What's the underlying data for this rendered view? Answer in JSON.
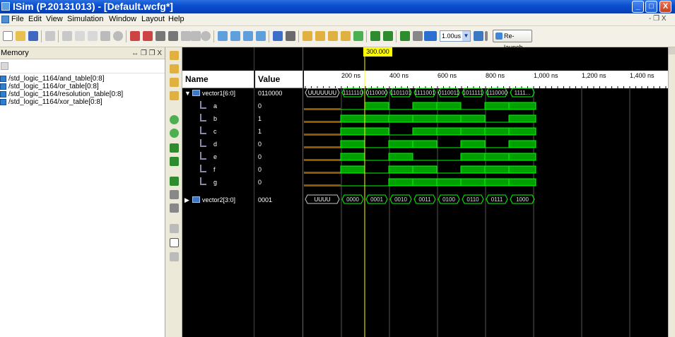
{
  "window": {
    "title": "ISim (P.20131013) - [Default.wcfg*]",
    "buttons": {
      "minimize": "_",
      "maximize": "□",
      "close": "X"
    }
  },
  "menu": {
    "items": [
      "File",
      "Edit",
      "View",
      "Simulation",
      "Window",
      "Layout",
      "Help"
    ],
    "window_controls": "- ❐ X"
  },
  "toolbar": {
    "run_time": "1.00us",
    "relaunch_label": "Re-launch"
  },
  "memory_panel": {
    "title": "Memory",
    "header_controls": "↔ ❐ ❐ X",
    "items": [
      "/std_logic_1164/and_table[0:8]",
      "/std_logic_1164/or_table[0:8]",
      "/std_logic_1164/resolution_table[0:8]",
      "/std_logic_1164/xor_table[0:8]"
    ]
  },
  "wave": {
    "cursor": "300.000 ns",
    "columns": {
      "name": "Name",
      "value": "Value"
    },
    "ruler_ticks": [
      "200 ns",
      "400 ns",
      "600 ns",
      "800 ns",
      "1,000 ns",
      "1,200 ns",
      "1,400 ns"
    ],
    "signals": [
      {
        "name": "vector1[6:0]",
        "value": "0110000",
        "type": "bus"
      },
      {
        "name": "a",
        "value": "0",
        "type": "bit"
      },
      {
        "name": "b",
        "value": "1",
        "type": "bit"
      },
      {
        "name": "c",
        "value": "1",
        "type": "bit"
      },
      {
        "name": "d",
        "value": "0",
        "type": "bit"
      },
      {
        "name": "e",
        "value": "0",
        "type": "bit"
      },
      {
        "name": "f",
        "value": "0",
        "type": "bit"
      },
      {
        "name": "g",
        "value": "0",
        "type": "bit"
      },
      {
        "name": "vector2[3:0]",
        "value": "0001",
        "type": "bus"
      }
    ],
    "vector1_segments": [
      "UUUUUUU",
      "1111110",
      "0110000",
      "1101101",
      "1111001",
      "0110011",
      "1011111",
      "1110000",
      "1111..."
    ],
    "vector2_segments": [
      "UUUU",
      "0000",
      "0001",
      "0010",
      "0011",
      "0100",
      "0110",
      "0111",
      "1000"
    ],
    "bit_levels": {
      "a": [
        0,
        1,
        0,
        1,
        1,
        0,
        1,
        1
      ],
      "b": [
        1,
        1,
        1,
        1,
        1,
        1,
        0,
        1
      ],
      "c": [
        1,
        1,
        0,
        1,
        1,
        1,
        1,
        1
      ],
      "d": [
        1,
        0,
        1,
        1,
        0,
        1,
        0,
        1
      ],
      "e": [
        1,
        0,
        1,
        0,
        0,
        1,
        1,
        1
      ],
      "f": [
        1,
        0,
        1,
        1,
        0,
        1,
        1,
        1
      ],
      "g": [
        0,
        0,
        1,
        1,
        1,
        1,
        1,
        1
      ]
    },
    "colors": {
      "bus": "#00ff00",
      "high": "#00a000",
      "uninit": "#8b5a00",
      "cursor": "#ffff00"
    }
  }
}
